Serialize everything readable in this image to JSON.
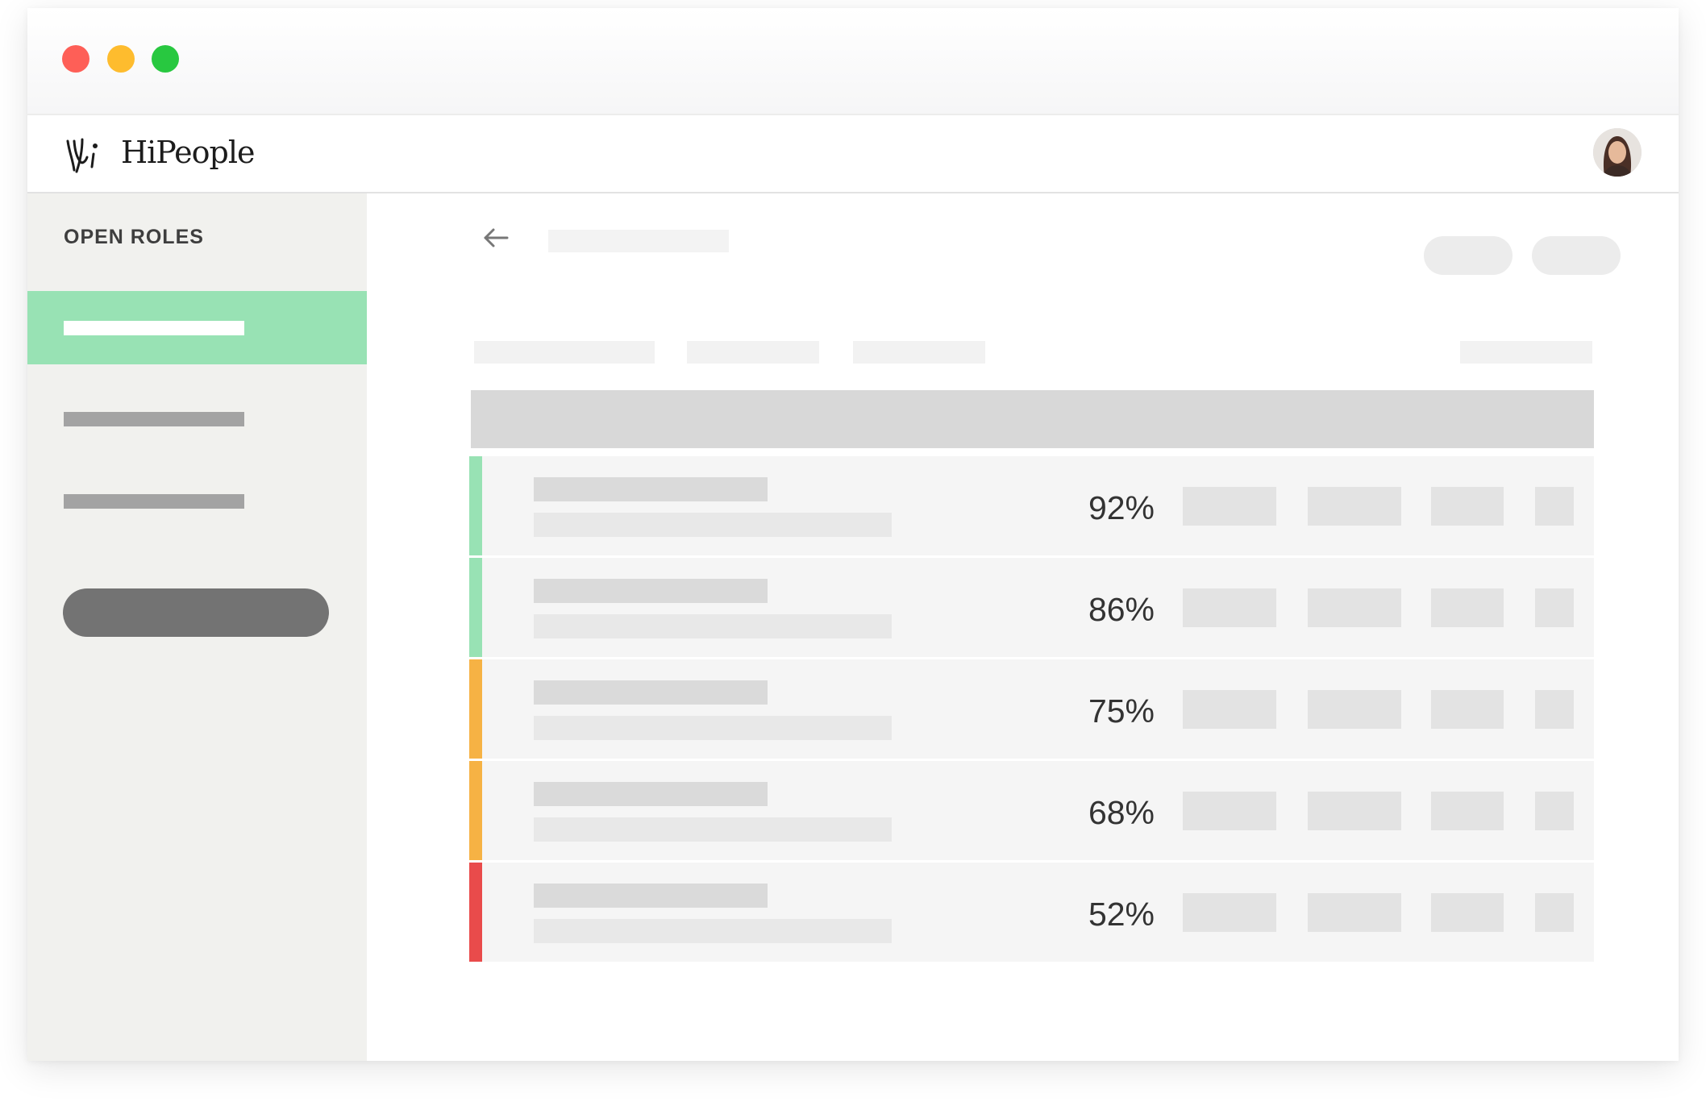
{
  "window": {
    "traffic_lights": {
      "close": "#fe5f57",
      "minimize": "#febc2e",
      "maximize": "#28c840"
    }
  },
  "header": {
    "brand": "HiPeople",
    "logo_icon": "hipeople-logo-icon",
    "avatar_icon": "user-avatar"
  },
  "sidebar": {
    "title": "OPEN ROLES",
    "active_color": "#98e2b4"
  },
  "main": {
    "back_icon": "arrow-left-icon",
    "rows": [
      {
        "score": "92%",
        "accent": "#98e2b4"
      },
      {
        "score": "86%",
        "accent": "#98e2b4"
      },
      {
        "score": "75%",
        "accent": "#f6b244"
      },
      {
        "score": "68%",
        "accent": "#f6b244"
      },
      {
        "score": "52%",
        "accent": "#e94b4b"
      }
    ]
  }
}
